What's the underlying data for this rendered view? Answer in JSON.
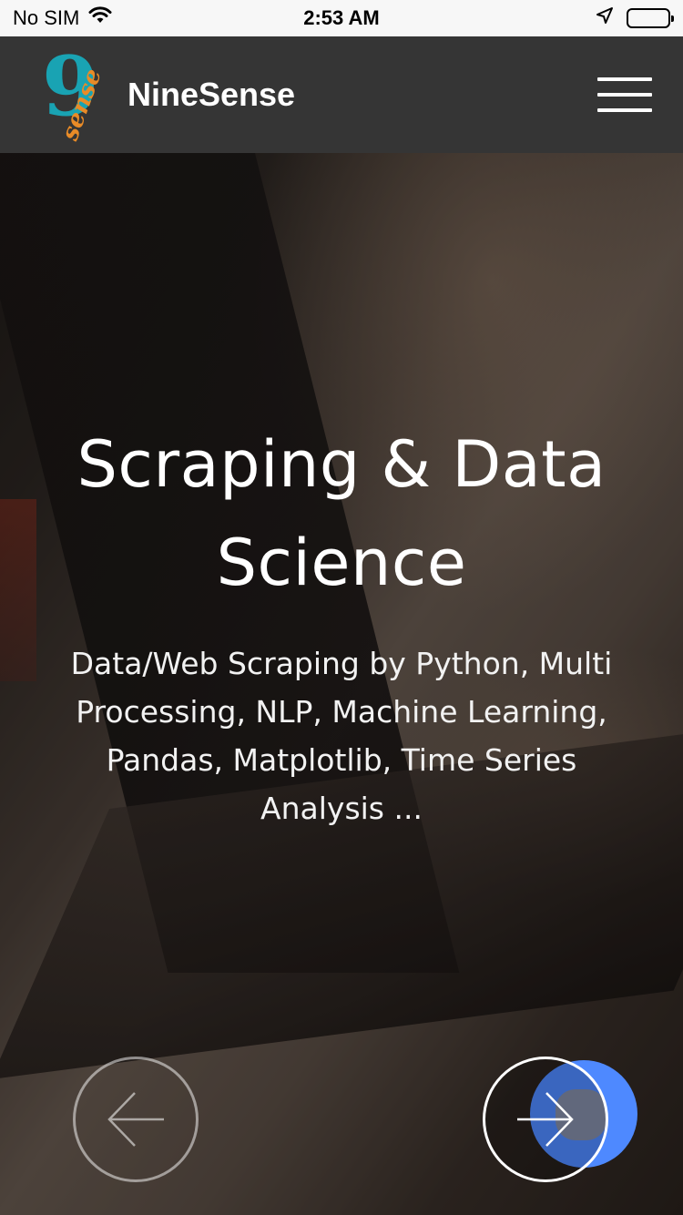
{
  "status_bar": {
    "carrier": "No SIM",
    "time": "2:53 AM",
    "icons": [
      "wifi-icon",
      "location-arrow-icon",
      "battery-icon"
    ]
  },
  "navbar": {
    "logo_nine": "9",
    "logo_sense": "sense",
    "brand": "NineSense",
    "menu_icon": "hamburger-menu-icon"
  },
  "hero": {
    "title": "Scraping & Data Science",
    "subtitle": "Data/Web Scraping by Python, Multi Processing, NLP, Machine Learning, Pandas, Matplotlib, Time Series Analysis ...",
    "prev_icon": "arrow-left-icon",
    "next_icon": "arrow-right-icon"
  },
  "colors": {
    "navbar_bg": "#353535",
    "logo_teal": "#19a3b3",
    "logo_orange": "#e98b27",
    "touch_highlight": "#4e89ff"
  }
}
